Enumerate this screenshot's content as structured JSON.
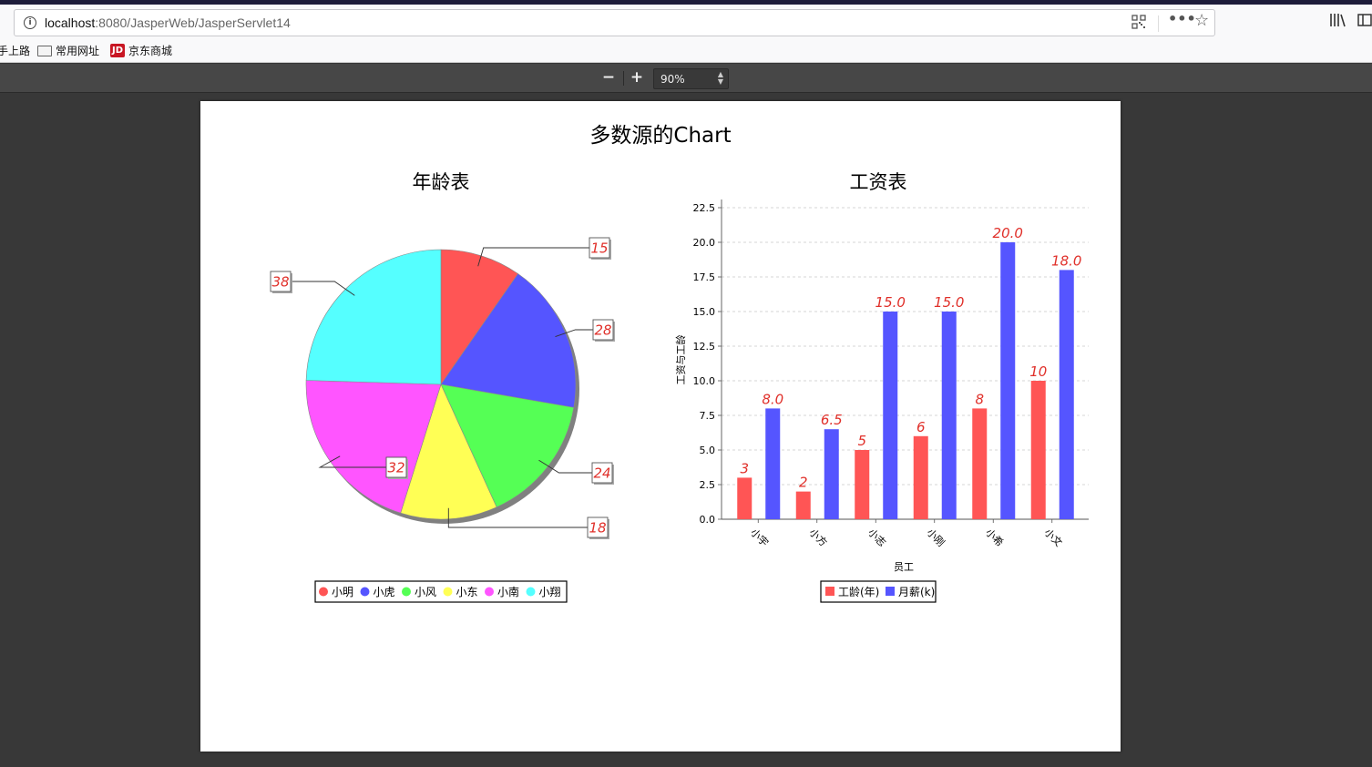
{
  "browser": {
    "url_host": "localhost",
    "url_rest": ":8080/JasperWeb/JasperServlet14",
    "bookmarks": [
      {
        "label": "手上路",
        "icon": "none"
      },
      {
        "label": "常用网址",
        "icon": "folder-icon"
      },
      {
        "label": "京东商城",
        "icon": "jd-icon"
      }
    ],
    "jd_icon_text": "JD"
  },
  "pdf_toolbar": {
    "zoom_out_label": "−",
    "zoom_in_label": "+",
    "zoom_value": "90%"
  },
  "report": {
    "title": "多数源的Chart"
  },
  "colors": {
    "red": "#ff5555",
    "blue": "#5555ff",
    "green": "#55ff55",
    "yellow": "#ffff55",
    "magenta": "#ff55ff",
    "cyan": "#55ffff",
    "label_red": "#e0302a"
  },
  "chart_data": [
    {
      "type": "pie",
      "title": "年龄表",
      "slices": [
        {
          "name": "小明",
          "value": 15,
          "label": "15",
          "color": "#ff5555"
        },
        {
          "name": "小虎",
          "value": 28,
          "label": "28",
          "color": "#5555ff"
        },
        {
          "name": "小风",
          "value": 24,
          "label": "24",
          "color": "#55ff55"
        },
        {
          "name": "小东",
          "value": 18,
          "label": "18",
          "color": "#ffff55"
        },
        {
          "name": "小南",
          "value": 32,
          "label": "32",
          "color": "#ff55ff"
        },
        {
          "name": "小翔",
          "value": 38,
          "label": "38",
          "color": "#55ffff"
        }
      ],
      "legend_placement": "bottom"
    },
    {
      "type": "bar",
      "title": "工资表",
      "xlabel": "员工",
      "ylabel": "工资与工龄",
      "categories": [
        "小宇",
        "小方",
        "小志",
        "小刚",
        "小希",
        "小文"
      ],
      "series": [
        {
          "name": "工龄(年)",
          "values": [
            3,
            2,
            5,
            6,
            8,
            10
          ],
          "labels": [
            "3",
            "2",
            "5",
            "6",
            "8",
            "10"
          ],
          "color": "#ff5555"
        },
        {
          "name": "月薪(k)",
          "values": [
            8.0,
            6.5,
            15.0,
            15.0,
            20.0,
            18.0
          ],
          "labels": [
            "8.0",
            "6.5",
            "15.0",
            "15.0",
            "20.0",
            "18.0"
          ],
          "color": "#5555ff"
        }
      ],
      "ylim": [
        0,
        22.5
      ],
      "yticks": [
        "0.0",
        "2.5",
        "5.0",
        "7.5",
        "10.0",
        "12.5",
        "15.0",
        "17.5",
        "20.0",
        "22.5"
      ],
      "grid": true,
      "legend_placement": "bottom"
    }
  ]
}
